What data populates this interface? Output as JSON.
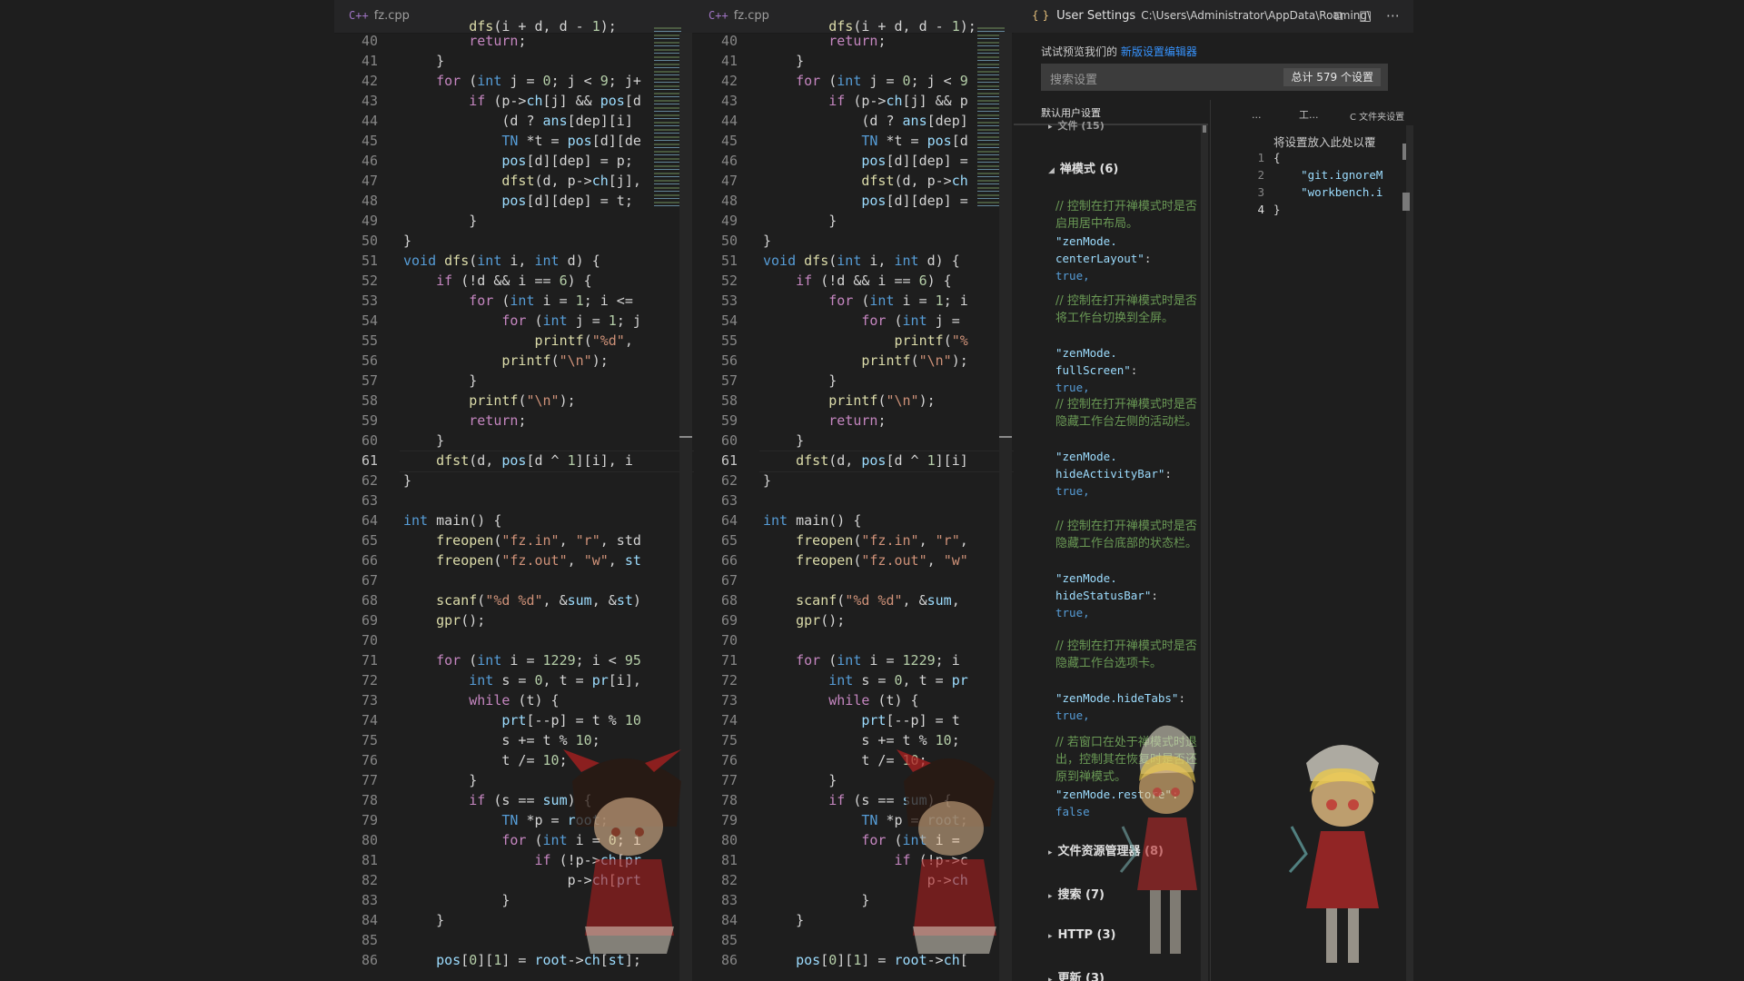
{
  "left_editor": {
    "tab_icon": "C++",
    "tab_label": "fz.cpp",
    "current_line": 61,
    "first_line_partial": "        dfs(i + d, d - 1);",
    "lines": [
      {
        "n": 40,
        "t": "        return;"
      },
      {
        "n": 41,
        "t": "    }"
      },
      {
        "n": 42,
        "t": "    for (int j = 0; j < 9; j+"
      },
      {
        "n": 43,
        "t": "        if (p->ch[j] && pos[d"
      },
      {
        "n": 44,
        "t": "            (d ? ans[dep][i]"
      },
      {
        "n": 45,
        "t": "            TN *t = pos[d][de"
      },
      {
        "n": 46,
        "t": "            pos[d][dep] = p;"
      },
      {
        "n": 47,
        "t": "            dfst(d, p->ch[j],"
      },
      {
        "n": 48,
        "t": "            pos[d][dep] = t;"
      },
      {
        "n": 49,
        "t": "        }"
      },
      {
        "n": 50,
        "t": "}"
      },
      {
        "n": 51,
        "t": "void dfs(int i, int d) {"
      },
      {
        "n": 52,
        "t": "    if (!d && i == 6) {"
      },
      {
        "n": 53,
        "t": "        for (int i = 1; i <="
      },
      {
        "n": 54,
        "t": "            for (int j = 1; j"
      },
      {
        "n": 55,
        "t": "                printf(\"%d\","
      },
      {
        "n": 56,
        "t": "            printf(\"\\n\");"
      },
      {
        "n": 57,
        "t": "        }"
      },
      {
        "n": 58,
        "t": "        printf(\"\\n\");"
      },
      {
        "n": 59,
        "t": "        return;"
      },
      {
        "n": 60,
        "t": "    }"
      },
      {
        "n": 61,
        "t": "    dfst(d, pos[d ^ 1][i], i"
      },
      {
        "n": 62,
        "t": "}"
      },
      {
        "n": 63,
        "t": ""
      },
      {
        "n": 64,
        "t": "int main() {"
      },
      {
        "n": 65,
        "t": "    freopen(\"fz.in\", \"r\", std"
      },
      {
        "n": 66,
        "t": "    freopen(\"fz.out\", \"w\", st"
      },
      {
        "n": 67,
        "t": ""
      },
      {
        "n": 68,
        "t": "    scanf(\"%d %d\", &sum, &st)"
      },
      {
        "n": 69,
        "t": "    gpr();"
      },
      {
        "n": 70,
        "t": ""
      },
      {
        "n": 71,
        "t": "    for (int i = 1229; i < 95"
      },
      {
        "n": 72,
        "t": "        int s = 0, t = pr[i],"
      },
      {
        "n": 73,
        "t": "        while (t) {"
      },
      {
        "n": 74,
        "t": "            prt[--p] = t % 10"
      },
      {
        "n": 75,
        "t": "            s += t % 10;"
      },
      {
        "n": 76,
        "t": "            t /= 10;"
      },
      {
        "n": 77,
        "t": "        }"
      },
      {
        "n": 78,
        "t": "        if (s == sum) {"
      },
      {
        "n": 79,
        "t": "            TN *p = root;"
      },
      {
        "n": 80,
        "t": "            for (int i = 0; i"
      },
      {
        "n": 81,
        "t": "                if (!p->ch[pr"
      },
      {
        "n": 82,
        "t": "                    p->ch[prt"
      },
      {
        "n": 83,
        "t": "            }"
      },
      {
        "n": 84,
        "t": "    }"
      },
      {
        "n": 85,
        "t": ""
      },
      {
        "n": 86,
        "t": "    pos[0][1] = root->ch[st];"
      }
    ]
  },
  "right_editor": {
    "tab_icon": "C++",
    "tab_label": "fz.cpp",
    "current_line": 61,
    "first_line_partial": "        dfs(i + d, d - 1);",
    "lines": [
      {
        "n": 40,
        "t": "        return;"
      },
      {
        "n": 41,
        "t": "    }"
      },
      {
        "n": 42,
        "t": "    for (int j = 0; j < 9"
      },
      {
        "n": 43,
        "t": "        if (p->ch[j] && p"
      },
      {
        "n": 44,
        "t": "            (d ? ans[dep]"
      },
      {
        "n": 45,
        "t": "            TN *t = pos[d"
      },
      {
        "n": 46,
        "t": "            pos[d][dep] ="
      },
      {
        "n": 47,
        "t": "            dfst(d, p->ch"
      },
      {
        "n": 48,
        "t": "            pos[d][dep] ="
      },
      {
        "n": 49,
        "t": "        }"
      },
      {
        "n": 50,
        "t": "}"
      },
      {
        "n": 51,
        "t": "void dfs(int i, int d) {"
      },
      {
        "n": 52,
        "t": "    if (!d && i == 6) {"
      },
      {
        "n": 53,
        "t": "        for (int i = 1; i"
      },
      {
        "n": 54,
        "t": "            for (int j ="
      },
      {
        "n": 55,
        "t": "                printf(\"%"
      },
      {
        "n": 56,
        "t": "            printf(\"\\n\");"
      },
      {
        "n": 57,
        "t": "        }"
      },
      {
        "n": 58,
        "t": "        printf(\"\\n\");"
      },
      {
        "n": 59,
        "t": "        return;"
      },
      {
        "n": 60,
        "t": "    }"
      },
      {
        "n": 61,
        "t": "    dfst(d, pos[d ^ 1][i]"
      },
      {
        "n": 62,
        "t": "}"
      },
      {
        "n": 63,
        "t": ""
      },
      {
        "n": 64,
        "t": "int main() {"
      },
      {
        "n": 65,
        "t": "    freopen(\"fz.in\", \"r\","
      },
      {
        "n": 66,
        "t": "    freopen(\"fz.out\", \"w\""
      },
      {
        "n": 67,
        "t": ""
      },
      {
        "n": 68,
        "t": "    scanf(\"%d %d\", &sum,"
      },
      {
        "n": 69,
        "t": "    gpr();"
      },
      {
        "n": 70,
        "t": ""
      },
      {
        "n": 71,
        "t": "    for (int i = 1229; i"
      },
      {
        "n": 72,
        "t": "        int s = 0, t = pr"
      },
      {
        "n": 73,
        "t": "        while (t) {"
      },
      {
        "n": 74,
        "t": "            prt[--p] = t"
      },
      {
        "n": 75,
        "t": "            s += t % 10;"
      },
      {
        "n": 76,
        "t": "            t /= 10;"
      },
      {
        "n": 77,
        "t": "        }"
      },
      {
        "n": 78,
        "t": "        if (s == sum) {"
      },
      {
        "n": 79,
        "t": "            TN *p = root;"
      },
      {
        "n": 80,
        "t": "            for (int i ="
      },
      {
        "n": 81,
        "t": "                if (!p->c"
      },
      {
        "n": 82,
        "t": "                    p->ch"
      },
      {
        "n": 83,
        "t": "            }"
      },
      {
        "n": 84,
        "t": "    }"
      },
      {
        "n": 85,
        "t": ""
      },
      {
        "n": 86,
        "t": "    pos[0][1] = root->ch["
      }
    ]
  },
  "settings": {
    "header_icon": "{ }",
    "title": "User Settings",
    "path": "C:\\Users\\Administrator\\AppData\\Roaming\\",
    "preview_text": "试试预览我们的",
    "preview_link": "新版设置编辑器",
    "search_placeholder": "搜索设置",
    "count_badge": "总计 579 个设置",
    "tab_default": "默认用户设置",
    "tab_user": "...",
    "tab_workspace": "工...",
    "tab_folder": "C 文件夹设置",
    "group_partial": "文件 (15)",
    "zen_group": "禅模式 (6)",
    "zen_items": [
      {
        "comment": "// 控制在打开禅模式时是否启用居中布局。",
        "key1": "\"zenMode.",
        "key2": "centerLayout\"",
        "value": "true,"
      },
      {
        "comment": "// 控制在打开禅模式时是否将工作台切换到全屏。",
        "key1": "\"zenMode.",
        "key2": "fullScreen\"",
        "value": "true,"
      },
      {
        "comment": "// 控制在打开禅模式时是否隐藏工作台左侧的活动栏。",
        "key1": "\"zenMode.",
        "key2": "hideActivityBar\"",
        "value": "true,"
      },
      {
        "comment": "// 控制在打开禅模式时是否隐藏工作台底部的状态栏。",
        "key1": "\"zenMode.",
        "key2": "hideStatusBar\"",
        "value": "true,"
      },
      {
        "comment": "// 控制在打开禅模式时是否隐藏工作台选项卡。",
        "key1": "\"zenMode.hideTabs\"",
        "key2": "",
        "value": "true,"
      },
      {
        "comment": "// 若窗口在处于禅模式时退出，控制其在恢复时是否还原到禅模式。",
        "key1": "\"zenMode.restore\"",
        "key2": "",
        "value": "false"
      }
    ],
    "groups_below": [
      "文件资源管理器 (8)",
      "搜索 (7)",
      "HTTP (3)",
      "更新 (3)"
    ],
    "right_hint": "将设置放入此处以覆",
    "right_lines": [
      {
        "n": 1,
        "t": "{"
      },
      {
        "n": 2,
        "t": "    \"git.ignoreM"
      },
      {
        "n": 3,
        "t": "    \"workbench.i"
      },
      {
        "n": 4,
        "t": "}"
      }
    ],
    "right_current": 4
  },
  "icons": {
    "split_editor": "split-editor-icon",
    "open_json": "open-json-icon",
    "more": "more-actions-icon",
    "edit_pencil": "edit-pencil-icon"
  }
}
